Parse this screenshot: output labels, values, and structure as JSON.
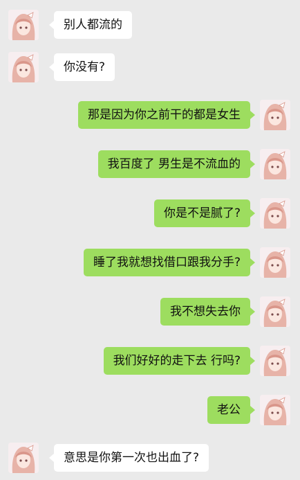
{
  "messages": [
    {
      "side": "in",
      "text": "别人都流的"
    },
    {
      "side": "in",
      "text": "你没有?"
    },
    {
      "side": "out",
      "text": "那是因为你之前干的都是女生"
    },
    {
      "side": "out",
      "text": "我百度了  男生是不流血的"
    },
    {
      "side": "out",
      "text": "你是不是腻了?"
    },
    {
      "side": "out",
      "text": "睡了我就想找借口跟我分手?"
    },
    {
      "side": "out",
      "text": "我不想失去你"
    },
    {
      "side": "out",
      "text": "我们好好的走下去 行吗?"
    },
    {
      "side": "out",
      "text": "老公"
    },
    {
      "side": "in",
      "text": "意思是你第一次也出血了?"
    }
  ],
  "colors": {
    "background": "#eaeaea",
    "incoming_bubble": "#ffffff",
    "outgoing_bubble": "#9ddd5f"
  },
  "avatar_icon": "anime-girl-avatar-icon"
}
